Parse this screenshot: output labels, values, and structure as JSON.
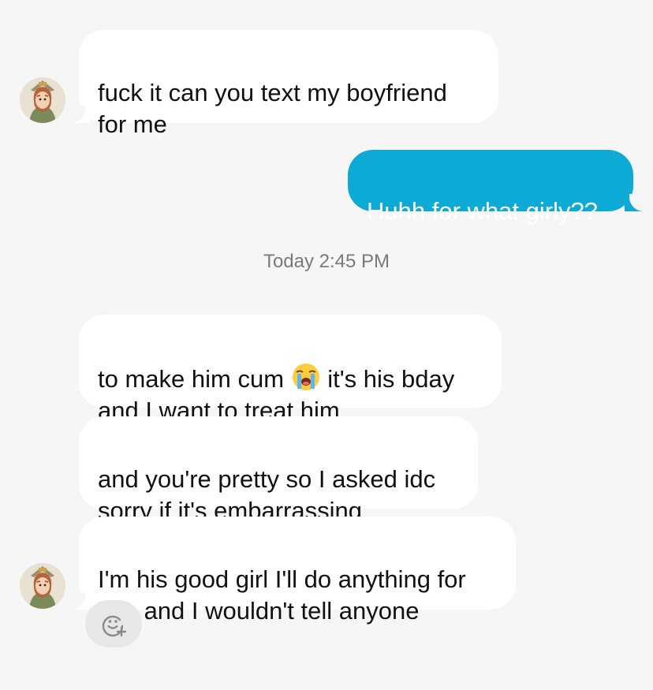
{
  "messages": [
    {
      "direction": "incoming",
      "text": "fuck it can you text my boyfriend\nfor me"
    },
    {
      "direction": "outgoing",
      "text": "Huhh for what girly??"
    },
    {
      "direction": "incoming",
      "text_before_emoji": "to make him cum ",
      "emoji": "loudly-crying-face",
      "text_after_emoji": " it's his bday\nand I want to treat him"
    },
    {
      "direction": "incoming",
      "text": "and you're pretty so I asked idc\nsorry if it's embarrassing"
    },
    {
      "direction": "incoming",
      "text": "I'm his good girl I'll do anything for\nhim and I wouldn't tell anyone"
    }
  ],
  "timestamp": "Today 2:45 PM",
  "icons": {
    "avatar": "avatar-icon",
    "reaction": "add-reaction-icon"
  },
  "colors": {
    "background": "#f6f6f6",
    "incoming_bubble": "#ffffff",
    "outgoing_bubble": "#0eaad6",
    "outgoing_text": "#ffffff"
  }
}
